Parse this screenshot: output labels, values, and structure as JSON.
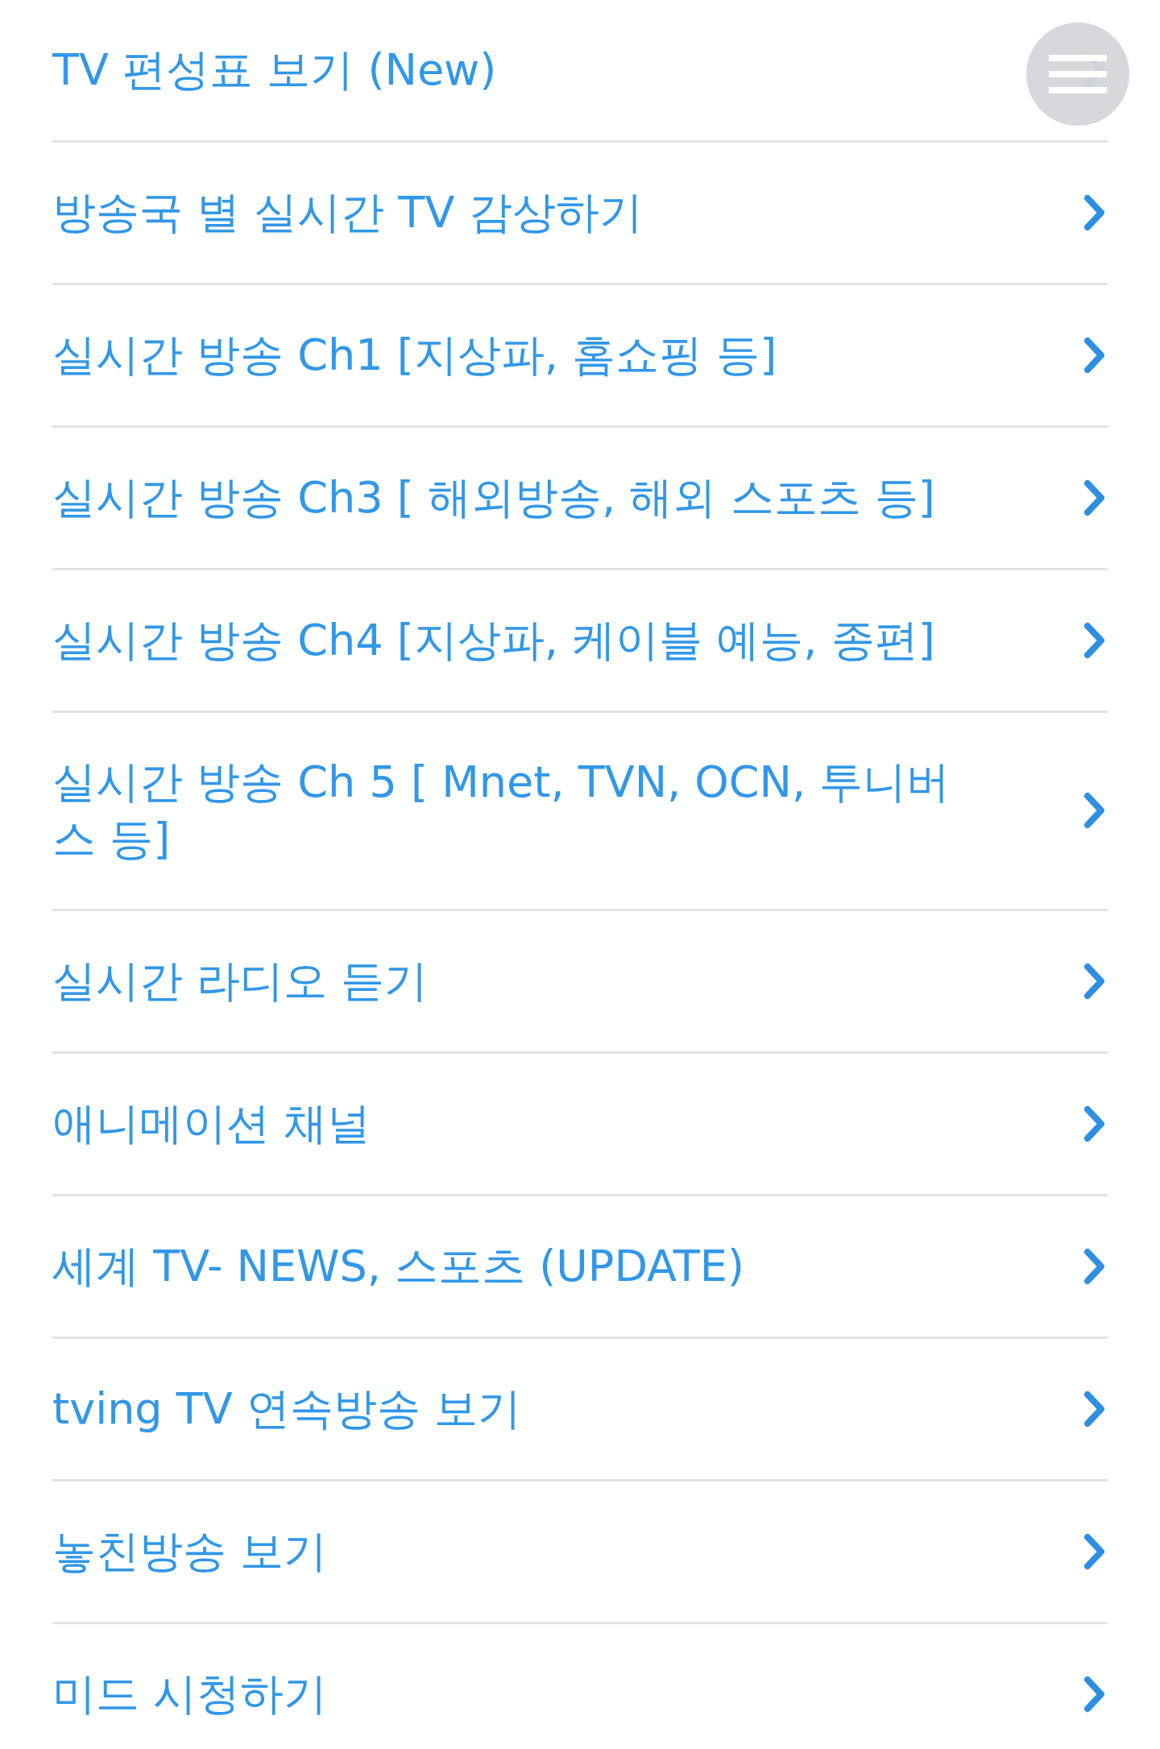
{
  "items": [
    {
      "label": "TV 편성표 보기 (New)"
    },
    {
      "label": "방송국 별 실시간 TV 감상하기"
    },
    {
      "label": "실시간 방송 Ch1 [지상파, 홈쇼핑 등]"
    },
    {
      "label": "실시간 방송 Ch3 [ 해외방송, 해외 스포츠 등]"
    },
    {
      "label": "실시간 방송 Ch4 [지상파, 케이블 예능, 종편]"
    },
    {
      "label": "실시간 방송 Ch 5 [ Mnet, TVN, OCN, 투니버스 등]"
    },
    {
      "label": "실시간 라디오 듣기"
    },
    {
      "label": "애니메이션 채널"
    },
    {
      "label": "세계 TV- NEWS, 스포츠 (UPDATE)"
    },
    {
      "label": "tving TV 연속방송 보기"
    },
    {
      "label": "놓친방송 보기"
    },
    {
      "label": "미드 시청하기"
    }
  ]
}
